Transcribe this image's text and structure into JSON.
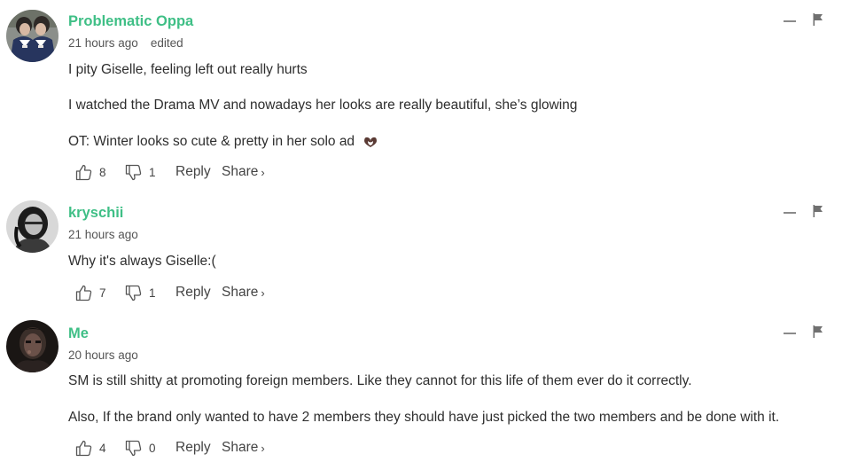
{
  "comments": [
    {
      "author": "Problematic Oppa",
      "time": "21 hours ago",
      "edited": "edited",
      "lines": [
        "I pity Giselle, feeling left out really hurts",
        "I watched the Drama MV and nowadays her looks are really beautiful, she’s glowing",
        "OT: Winter looks so cute & pretty in her solo ad"
      ],
      "likes": "8",
      "dislikes": "1",
      "avatar_icon": "two-girls-uniform-photo"
    },
    {
      "author": "kryschii",
      "time": "21 hours ago",
      "lines": [
        "Why it's always Giselle:("
      ],
      "likes": "7",
      "dislikes": "1",
      "avatar_icon": "grayscale-portrait-photo"
    },
    {
      "author": "Me",
      "time": "20 hours ago",
      "lines": [
        "SM is still shitty at promoting foreign members. Like they cannot for this life of them ever do it correctly.",
        "Also, If the brand only wanted to have 2 members they should have just picked the two members and be done with it."
      ],
      "likes": "4",
      "dislikes": "0",
      "avatar_icon": "dark-face-photo"
    }
  ],
  "labels": {
    "reply": "Reply",
    "share": "Share",
    "share_chevron": "›"
  },
  "icons": {
    "emoji": "heart-hands-emoji",
    "like": "thumbs-up-icon",
    "dislike": "thumbs-down-icon",
    "collapse": "minus-icon",
    "flag": "flag-icon"
  },
  "colors": {
    "author": "#3fbf86",
    "text": "#2e2e2e",
    "meta": "#555555",
    "icon": "#555555"
  }
}
